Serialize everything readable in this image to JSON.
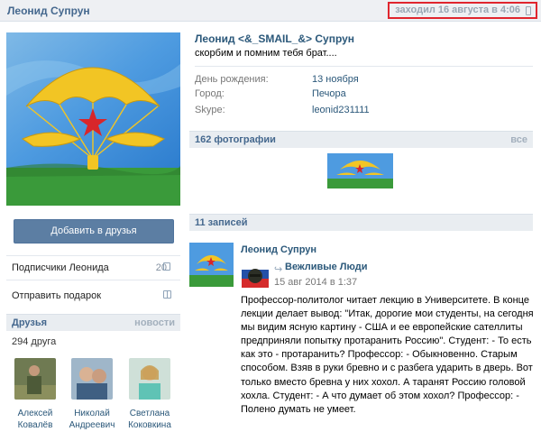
{
  "header": {
    "name": "Леонид Супрун",
    "last_seen": "заходил 16 августа в 4:06"
  },
  "left": {
    "add_friend_button": "Добавить в друзья",
    "subscribers": {
      "label": "Подписчики Леонида",
      "count": "20"
    },
    "send_gift": "Отправить подарок",
    "friends": {
      "title": "Друзья",
      "link": "новости",
      "count": "294 друга",
      "items": [
        {
          "first": "Алексей",
          "last": "Ковалёв"
        },
        {
          "first": "Николай",
          "last": "Андреевич"
        },
        {
          "first": "Светлана",
          "last": "Коковкина"
        }
      ]
    }
  },
  "profile": {
    "full_name": "Леонид <&_SMAIL_&> Супрун",
    "status": "скорбим и помним тебя брат....",
    "info": [
      {
        "label": "День рождения:",
        "value": "13 ноября"
      },
      {
        "label": "Город:",
        "value": "Печора"
      },
      {
        "label": "Skype:",
        "value": "leonid231111"
      }
    ]
  },
  "photos": {
    "title": "162 фотографии",
    "link": "все"
  },
  "wall": {
    "title": "11 записей",
    "post": {
      "author": "Леонид Супрун",
      "repost_source": "Вежливые Люди",
      "date": "15 авг 2014 в 1:37",
      "text": "Профессор-политолог читает лекцию в Университете. В конце лекции делает вывод: \"Итак, дорогие мои студенты, на сегодня мы видим ясную картину - США и ее европейские сателлиты предприняли попытку протаранить Россию\". Студент: - То есть как это - протаранить? Профессор: - Обыкновенно. Старым способом. Взяв в руки бревно и с разбега ударить в дверь. Вот только вместо бревна у них хохол. А таранят Россию головой хохла. Студент: - А что думает об этом хохол? Профессор: - Полено думать не умеет."
    }
  },
  "colors": {
    "link": "#2b587a",
    "header_link": "#45688e",
    "button": "#5c7ea3",
    "highlight_border": "#e0262e"
  }
}
